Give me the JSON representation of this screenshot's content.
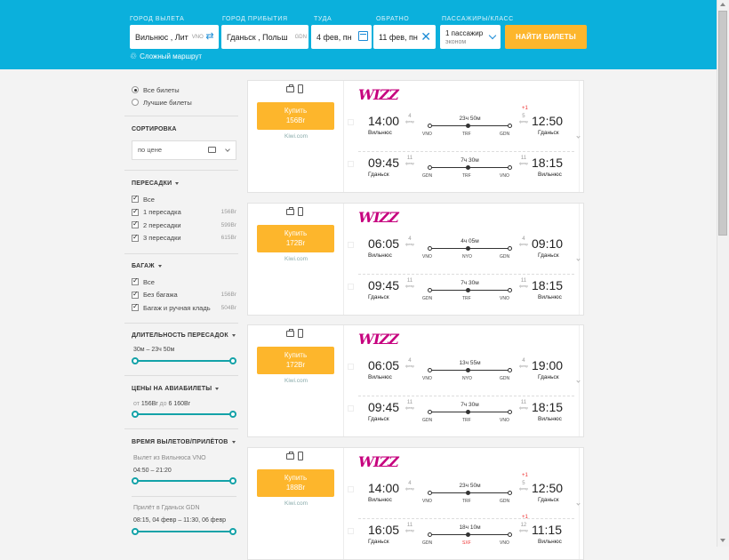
{
  "search": {
    "from_label": "ГОРОД ВЫЛЕТА",
    "to_label": "ГОРОД ПРИБЫТИЯ",
    "depart_label": "ТУДА",
    "return_label": "ОБРАТНО",
    "pax_label": "ПАССАЖИРЫ/КЛАСС",
    "from_value": "Вильнюс , Лит",
    "from_code": "VNO",
    "to_value": "Гданьск , Польш",
    "to_code": "GDN",
    "depart_value": "4 фев, пн",
    "return_value": "11 фев, пн",
    "pax_value": "1 пассажир",
    "class_value": "эконом",
    "search_button": "НАЙТИ БИЛЕТЫ",
    "multi_route": "Сложный маршрут"
  },
  "sidebar": {
    "view_options": [
      {
        "label": "Все билеты",
        "selected": true
      },
      {
        "label": "Лучшие билеты",
        "selected": false
      }
    ],
    "sort_title": "СОРТИРОВКА",
    "sort_value": "по цене",
    "stops_title": "ПЕРЕСАДКИ",
    "stops": [
      {
        "label": "Все",
        "price": ""
      },
      {
        "label": "1 пересадка",
        "price": "156Br"
      },
      {
        "label": "2 пересадки",
        "price": "599Br"
      },
      {
        "label": "3 пересадки",
        "price": "615Br"
      }
    ],
    "baggage_title": "БАГАЖ",
    "baggage": [
      {
        "label": "Все",
        "price": ""
      },
      {
        "label": "Без багажа",
        "price": "156Br"
      },
      {
        "label": "Багаж и ручная кладь",
        "price": "504Br"
      }
    ],
    "layover_title": "ДЛИТЕЛЬНОСТЬ ПЕРЕСАДОК",
    "layover_range": "30м – 23ч 50м",
    "prices_title": "ЦЕНЫ НА АВИАБИЛЕТЫ",
    "price_from_prefix": "от",
    "price_from": "156Br",
    "price_to_prefix": "до",
    "price_to": "6 160Br",
    "times_title": "ВРЕМЯ ВЫЛЕТОВ/ПРИЛЁТОВ",
    "depart_from_label": "Вылет из Вильнюса VNO",
    "depart_range": "04:50 – 21:20",
    "arrive_label": "Прилёт в Гданьск GDN",
    "arrive_range": "08:15, 04 февр – 11:30, 06 февр"
  },
  "results": [
    {
      "buy": "Купить",
      "price": "156Br",
      "agent": "Kiwi.com",
      "airline": "WIZZ",
      "segments": [
        {
          "dep_time": "14:00",
          "dep_day": "4",
          "dep_mon": "февр",
          "dep_city": "Вильнюс",
          "arr_time": "12:50",
          "arr_day": "5",
          "arr_mon": "февр",
          "arr_plus": "+1",
          "arr_city": "Гданьск",
          "duration": "23ч 50м",
          "airports": [
            "VNO",
            "TRF",
            "GDN"
          ],
          "mid_red": false
        },
        {
          "dep_time": "09:45",
          "dep_day": "11",
          "dep_mon": "февр",
          "dep_city": "Гданьск",
          "arr_time": "18:15",
          "arr_day": "11",
          "arr_mon": "февр",
          "arr_plus": "",
          "arr_city": "Вильнюс",
          "duration": "7ч 30м",
          "airports": [
            "GDN",
            "TRF",
            "VNO"
          ],
          "mid_red": false
        }
      ]
    },
    {
      "buy": "Купить",
      "price": "172Br",
      "agent": "Kiwi.com",
      "airline": "WIZZ",
      "segments": [
        {
          "dep_time": "06:05",
          "dep_day": "4",
          "dep_mon": "февр",
          "dep_city": "Вильнюс",
          "arr_time": "09:10",
          "arr_day": "4",
          "arr_mon": "февр",
          "arr_plus": "",
          "arr_city": "Гданьск",
          "duration": "4ч 05м",
          "airports": [
            "VNO",
            "NYO",
            "GDN"
          ],
          "mid_red": false
        },
        {
          "dep_time": "09:45",
          "dep_day": "11",
          "dep_mon": "февр",
          "dep_city": "Гданьск",
          "arr_time": "18:15",
          "arr_day": "11",
          "arr_mon": "февр",
          "arr_plus": "",
          "arr_city": "Вильнюс",
          "duration": "7ч 30м",
          "airports": [
            "GDN",
            "TRF",
            "VNO"
          ],
          "mid_red": false
        }
      ]
    },
    {
      "buy": "Купить",
      "price": "172Br",
      "agent": "Kiwi.com",
      "airline": "WIZZ",
      "segments": [
        {
          "dep_time": "06:05",
          "dep_day": "4",
          "dep_mon": "февр",
          "dep_city": "Вильнюс",
          "arr_time": "19:00",
          "arr_day": "4",
          "arr_mon": "февр",
          "arr_plus": "",
          "arr_city": "Гданьск",
          "duration": "13ч 55м",
          "airports": [
            "VNO",
            "NYO",
            "GDN"
          ],
          "mid_red": false
        },
        {
          "dep_time": "09:45",
          "dep_day": "11",
          "dep_mon": "февр",
          "dep_city": "Гданьск",
          "arr_time": "18:15",
          "arr_day": "11",
          "arr_mon": "февр",
          "arr_plus": "",
          "arr_city": "Вильнюс",
          "duration": "7ч 30м",
          "airports": [
            "GDN",
            "TRF",
            "VNO"
          ],
          "mid_red": false
        }
      ]
    },
    {
      "buy": "Купить",
      "price": "188Br",
      "agent": "Kiwi.com",
      "airline": "WIZZ",
      "segments": [
        {
          "dep_time": "14:00",
          "dep_day": "4",
          "dep_mon": "февр",
          "dep_city": "Вильнюс",
          "arr_time": "12:50",
          "arr_day": "5",
          "arr_mon": "февр",
          "arr_plus": "+1",
          "arr_city": "Гданьск",
          "duration": "23ч 50м",
          "airports": [
            "VNO",
            "TRF",
            "GDN"
          ],
          "mid_red": false
        },
        {
          "dep_time": "16:05",
          "dep_day": "11",
          "dep_mon": "февр",
          "dep_city": "Гданьск",
          "arr_time": "11:15",
          "arr_day": "12",
          "arr_mon": "февр",
          "arr_plus": "+1",
          "arr_city": "Вильнюс",
          "duration": "18ч 10м",
          "airports": [
            "GDN",
            "SXF",
            "VNO"
          ],
          "mid_red": true
        }
      ]
    }
  ]
}
